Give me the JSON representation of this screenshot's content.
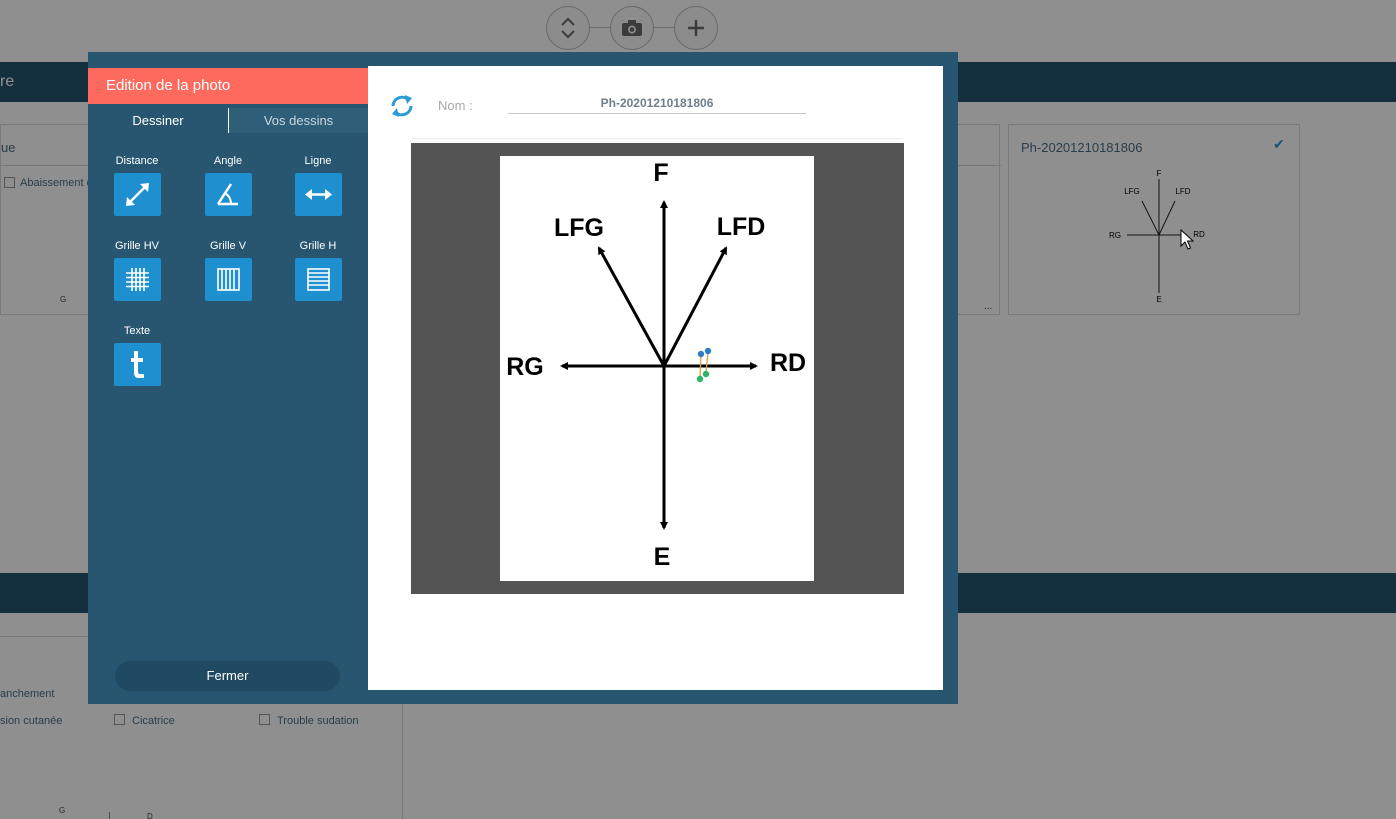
{
  "background": {
    "header_partial": "re",
    "card_left_title": "ue",
    "card_left_checkbox": "Abaissement d",
    "card_left_footer": "G",
    "card_right_title": "Ph-20201210181806",
    "card_ellipsis": "...",
    "thumb_labels": {
      "f": "F",
      "lfg": "LFG",
      "lfd": "LFD",
      "rg": "RG",
      "rd": "RD",
      "e": "E"
    },
    "lower_items": [
      "anchement",
      "sion cutanée",
      "Cicatrice",
      "Trouble sudation"
    ],
    "lower_footer_g": "G",
    "lower_footer_d": "D"
  },
  "modal": {
    "title": "Edition de la photo",
    "tabs": [
      {
        "label": "Dessiner",
        "active": true
      },
      {
        "label": "Vos dessins",
        "active": false
      }
    ],
    "tools": [
      {
        "label": "Distance",
        "icon": "distance-icon"
      },
      {
        "label": "Angle",
        "icon": "angle-icon"
      },
      {
        "label": "Ligne",
        "icon": "line-icon"
      },
      {
        "label": "Grille HV",
        "icon": "grid-hv-icon"
      },
      {
        "label": "Grille V",
        "icon": "grid-v-icon"
      },
      {
        "label": "Grille H",
        "icon": "grid-h-icon"
      },
      {
        "label": "Texte",
        "icon": "text-icon"
      }
    ],
    "close_label": "Fermer",
    "name_label": "Nom :",
    "name_value": "Ph-20201210181806",
    "photo_labels": {
      "f": "F",
      "lfg": "LFG",
      "lfd": "LFD",
      "rg": "RG",
      "rd": "RD",
      "e": "E"
    }
  },
  "colors": {
    "modal_bg": "#285670",
    "header_accent": "#ff6a5f",
    "tool_button": "#1e8fcf",
    "bar": "#24566f",
    "canvas_bg": "#545454",
    "marker_blue": "#2f7fc0",
    "marker_green": "#2db36a"
  }
}
